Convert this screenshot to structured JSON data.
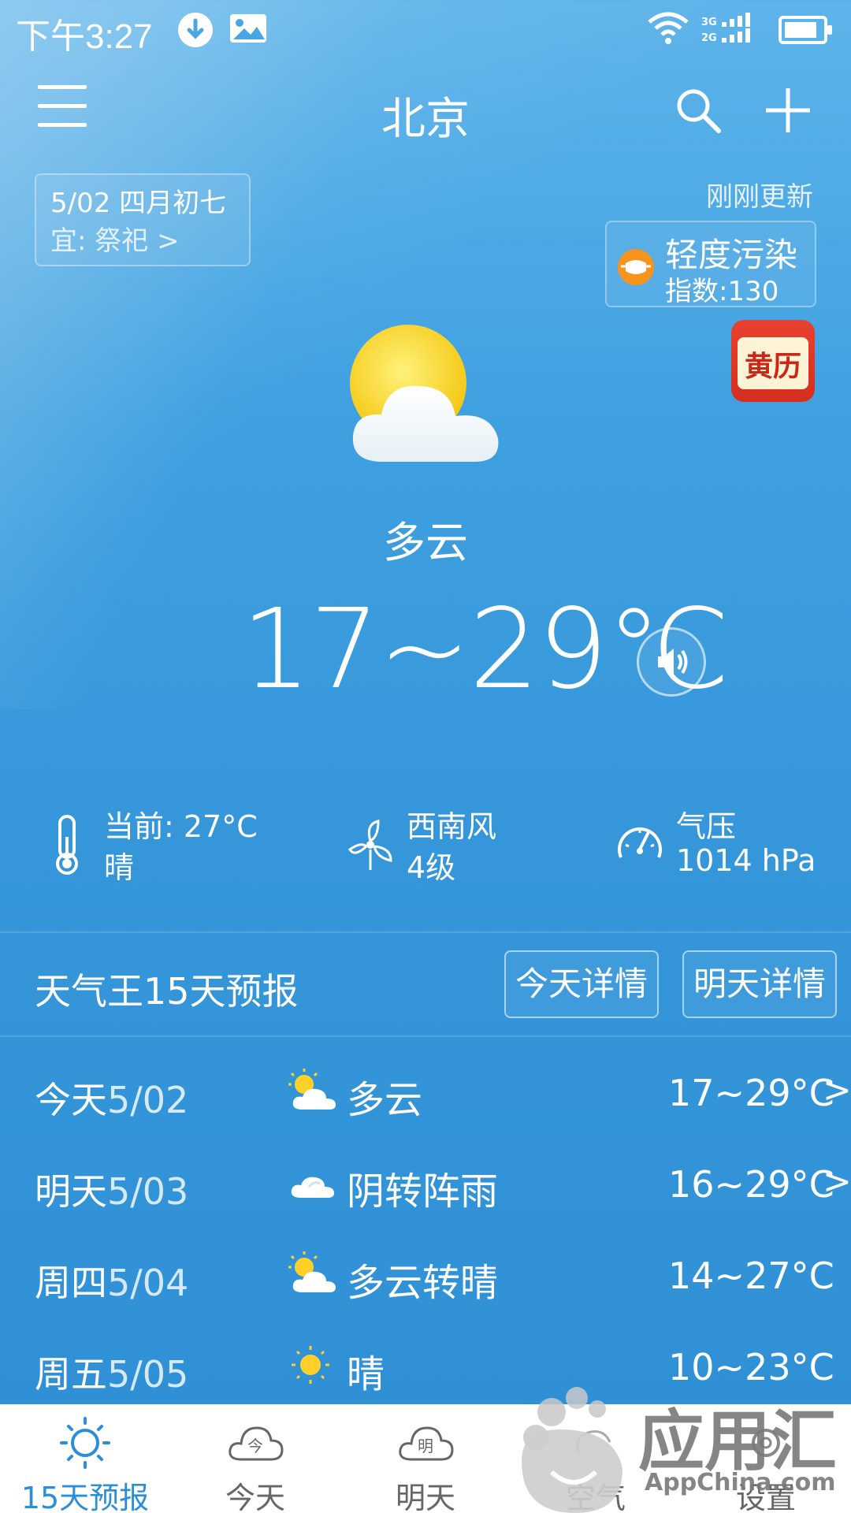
{
  "status_bar": {
    "time": "下午3:27",
    "net_labels": [
      "3G",
      "2G"
    ]
  },
  "header": {
    "city": "北京"
  },
  "date_card": {
    "date": "5/02",
    "lunar": "四月初七",
    "yi_label": "宜:",
    "yi_value": "祭祀",
    "chevron": ">"
  },
  "update_status": "刚刚更新",
  "air_quality": {
    "level": "轻度污染",
    "index": "指数:130",
    "color": "#f7941d"
  },
  "almanac": {
    "label": "黄历"
  },
  "today": {
    "condition": "多云",
    "temp_range": "17~29℃"
  },
  "stats": {
    "current": {
      "line1": "当前: 27°C",
      "line2": "晴"
    },
    "wind": {
      "line1": "西南风",
      "line2": "4级"
    },
    "pressure": {
      "line1": "气压",
      "line2": "1014 hPa"
    }
  },
  "forecast": {
    "title": "天气王15天预报",
    "today_button": "今天详情",
    "tomorrow_button": "明天详情",
    "days": [
      {
        "day": "今天",
        "date": "5/02",
        "icon": "partly-cloudy-icon",
        "condition": "多云",
        "range": "17~29°C",
        "chevron": ">"
      },
      {
        "day": "明天",
        "date": "5/03",
        "icon": "cloudy-icon",
        "condition": "阴转阵雨",
        "range": "16~29°C",
        "chevron": ">"
      },
      {
        "day": "周四",
        "date": "5/04",
        "icon": "partly-cloudy-icon",
        "condition": "多云转晴",
        "range": "14~27°C",
        "chevron": ""
      },
      {
        "day": "周五",
        "date": "5/05",
        "icon": "sunny-icon",
        "condition": "晴",
        "range": "10~23°C",
        "chevron": ""
      }
    ]
  },
  "bottom_nav": {
    "items": [
      {
        "label": "15天预报",
        "icon": "sun-icon",
        "icon_text": ""
      },
      {
        "label": "今天",
        "icon": "cloud-today-icon",
        "icon_text": "今"
      },
      {
        "label": "明天",
        "icon": "cloud-tomorrow-icon",
        "icon_text": "明"
      },
      {
        "label": "空气",
        "icon": "air-icon",
        "icon_text": ""
      },
      {
        "label": "设置",
        "icon": "gear-icon",
        "icon_text": ""
      }
    ],
    "active_color": "#2b8fd8"
  },
  "watermark": {
    "text": "应用汇",
    "subtext": "AppChina.com"
  }
}
